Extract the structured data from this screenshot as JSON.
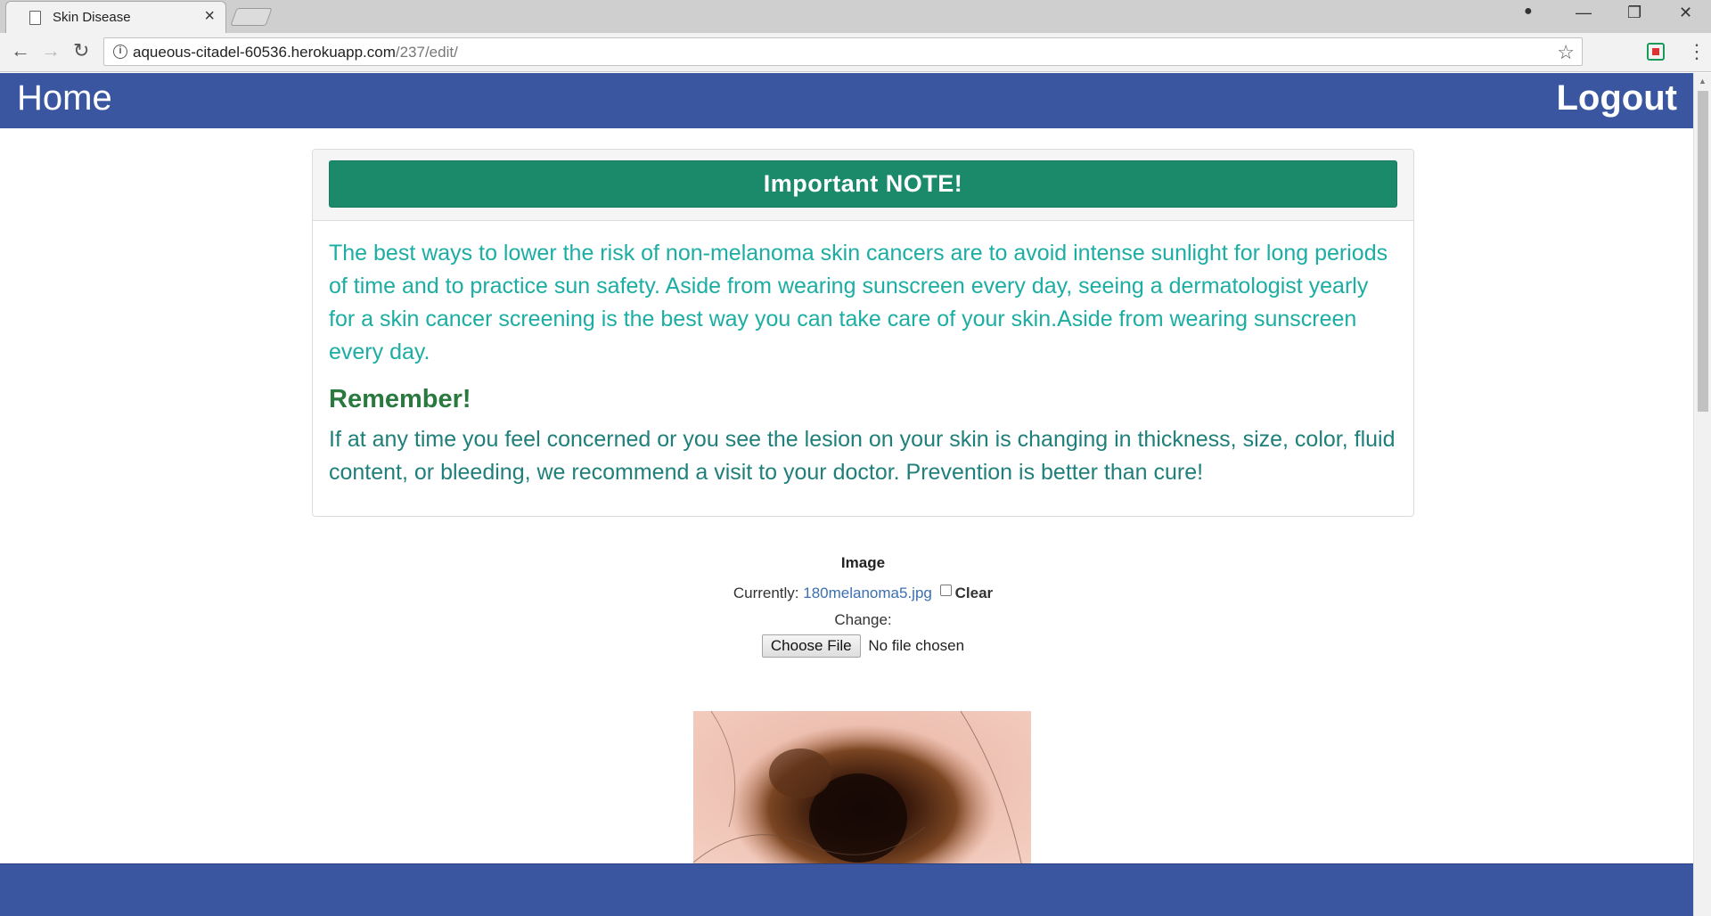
{
  "browser": {
    "tab_title": "Skin Disease",
    "tab_close": "×",
    "url_host": "aqueous-citadel-60536.herokuapp.com",
    "url_path": "/237/edit/",
    "window_controls": [
      "—",
      "❐",
      "✕"
    ]
  },
  "navbar": {
    "home_label": "Home",
    "logout_label": "Logout",
    "color": "#3a56a0"
  },
  "note": {
    "title": "Important NOTE!",
    "paragraph": "The best ways to lower the risk of non-melanoma skin cancers are to avoid intense sunlight for long periods of time and to practice sun safety. Aside from wearing sunscreen every day, seeing a dermatologist yearly for a skin cancer screening is the best way you can take care of your skin.Aside from wearing sunscreen every day.",
    "remember_heading": "Remember!",
    "remember_text": "If at any time you feel concerned or you see the lesion on your skin is changing in thickness, size, color, fluid content, or bleeding, we recommend a visit to your doctor. Prevention is better than cure!",
    "alert_color": "#1b8a6b"
  },
  "form": {
    "image_label": "Image",
    "currently_label": "Currently:",
    "current_file": "180melanoma5.jpg",
    "clear_label": "Clear",
    "change_label": "Change:",
    "choose_file_label": "Choose File",
    "no_file_text": "No file chosen"
  }
}
